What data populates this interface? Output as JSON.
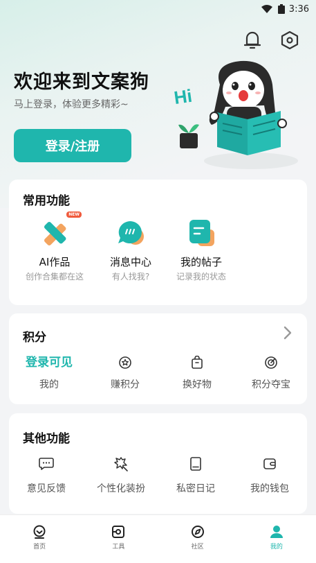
{
  "status_bar": {
    "time": "3:36"
  },
  "hero": {
    "title": "欢迎来到文案狗",
    "subtitle": "马上登录，体验更多精彩~",
    "login_label": "登录/注册",
    "mascot_text": "Hi"
  },
  "common": {
    "title": "常用功能",
    "items": [
      {
        "label": "AI作品",
        "desc": "创作合集都在这",
        "icon": "ruler-pencil-icon",
        "badge": "NEW"
      },
      {
        "label": "消息中心",
        "desc": "有人找我?",
        "icon": "chat-bubble-icon"
      },
      {
        "label": "我的帖子",
        "desc": "记录我的状态",
        "icon": "post-icon"
      }
    ]
  },
  "points": {
    "title": "积分",
    "items": [
      {
        "value": "登录可见",
        "label": "我的"
      },
      {
        "label": "赚积分",
        "icon": "star-coin-icon"
      },
      {
        "label": "换好物",
        "icon": "shopping-bag-icon"
      },
      {
        "label": "积分夺宝",
        "icon": "target-icon"
      }
    ]
  },
  "other": {
    "title": "其他功能",
    "items": [
      {
        "label": "意见反馈",
        "icon": "feedback-icon"
      },
      {
        "label": "个性化装扮",
        "icon": "dress-up-icon"
      },
      {
        "label": "私密日记",
        "icon": "diary-icon"
      },
      {
        "label": "我的钱包",
        "icon": "wallet-icon"
      }
    ]
  },
  "nav": [
    {
      "label": "首页",
      "icon": "home-icon"
    },
    {
      "label": "工具",
      "icon": "tools-icon"
    },
    {
      "label": "社区",
      "icon": "compass-icon"
    },
    {
      "label": "我的",
      "icon": "profile-icon",
      "active": true
    }
  ],
  "colors": {
    "accent": "#1fb6ad",
    "orange": "#f3a45f",
    "badge": "#f05a3c"
  }
}
